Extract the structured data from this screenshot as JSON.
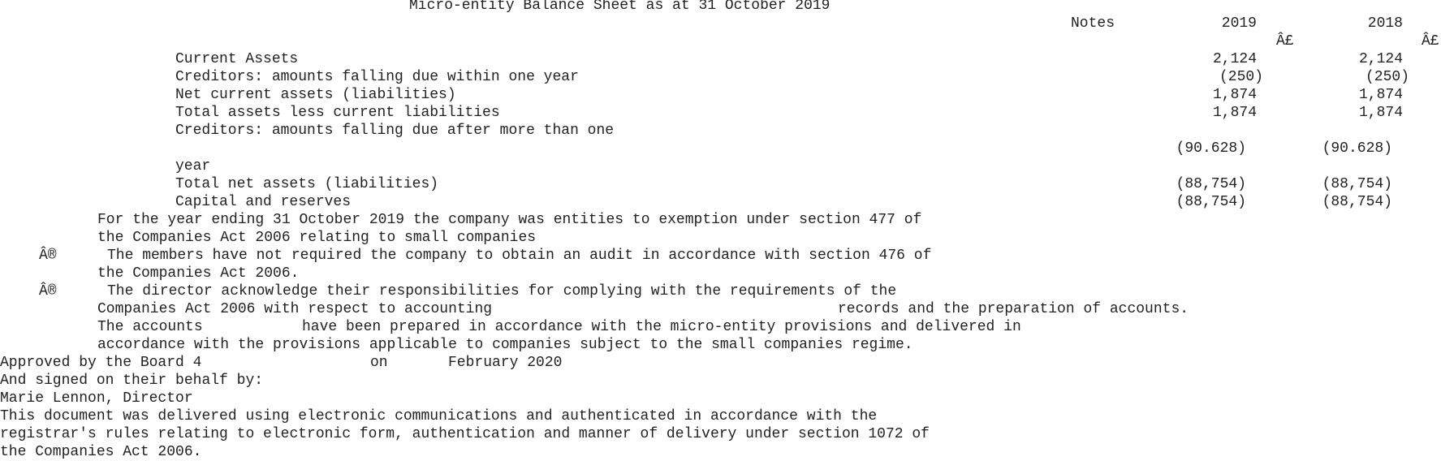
{
  "title": "Micro-entity Balance Sheet as at 31 October 2019",
  "columns": {
    "notes": "Notes",
    "year_current": "2019",
    "year_prior": "2018",
    "currency_current": "Â£",
    "currency_prior": "Â£"
  },
  "rows": [
    {
      "label": "Current Assets",
      "v2019": "2,124",
      "v2018": "2,124"
    },
    {
      "label": "Creditors: amounts falling due within one year",
      "v2019": "(250)",
      "v2018": "(250)"
    },
    {
      "label": "Net current assets (liabilities)",
      "v2019": "1,874",
      "v2018": "1,874"
    },
    {
      "label": "Total assets less current liabilities",
      "v2019": "1,874",
      "v2018": "1,874"
    },
    {
      "label": "Creditors: amounts falling due after more than one",
      "label_cont": "year",
      "v2019": "(90.628)",
      "v2018": "(90.628)"
    },
    {
      "label": "Total net assets (liabilities)",
      "v2019": "(88,754)",
      "v2018": "(88,754)"
    },
    {
      "label": "Capital and reserves",
      "v2019": "(88,754)",
      "v2018": "(88,754)"
    }
  ],
  "statement": {
    "exemption_line1": "For the year ending 31 October 2019 the company was entities to exemption under section 477 of",
    "exemption_line2": "the Companies Act 2006 relating to small companies",
    "bullet": "Â®",
    "audit_line1": "The members have not required the company to obtain an audit in accordance with section 476 of",
    "audit_line2": "the Companies Act 2006.",
    "director_line1": "The director acknowledge their responsibilities for complying with the requirements of the",
    "director_line2a": "Companies Act 2006 with respect to accounting",
    "director_line2b": "records and the preparation of accounts.",
    "accounts_line1a": "The accounts",
    "accounts_line1b": "have been prepared in accordance with the micro-entity provisions and delivered in",
    "accounts_line2": "accordance with the provisions applicable to companies subject to the small companies regime."
  },
  "approval": {
    "approved_a": "Approved by the Board 4",
    "approved_b": "on",
    "approved_c": "February 2020",
    "signed": "And signed on their behalf by:",
    "signatory": "Marie Lennon, Director"
  },
  "footer": {
    "line1": "This document was delivered using electronic communications and authenticated in accordance with the",
    "line2": "registrar's rules relating to electronic form, authentication and manner of delivery under section 1072 of",
    "line3": "the Companies Act 2006."
  }
}
